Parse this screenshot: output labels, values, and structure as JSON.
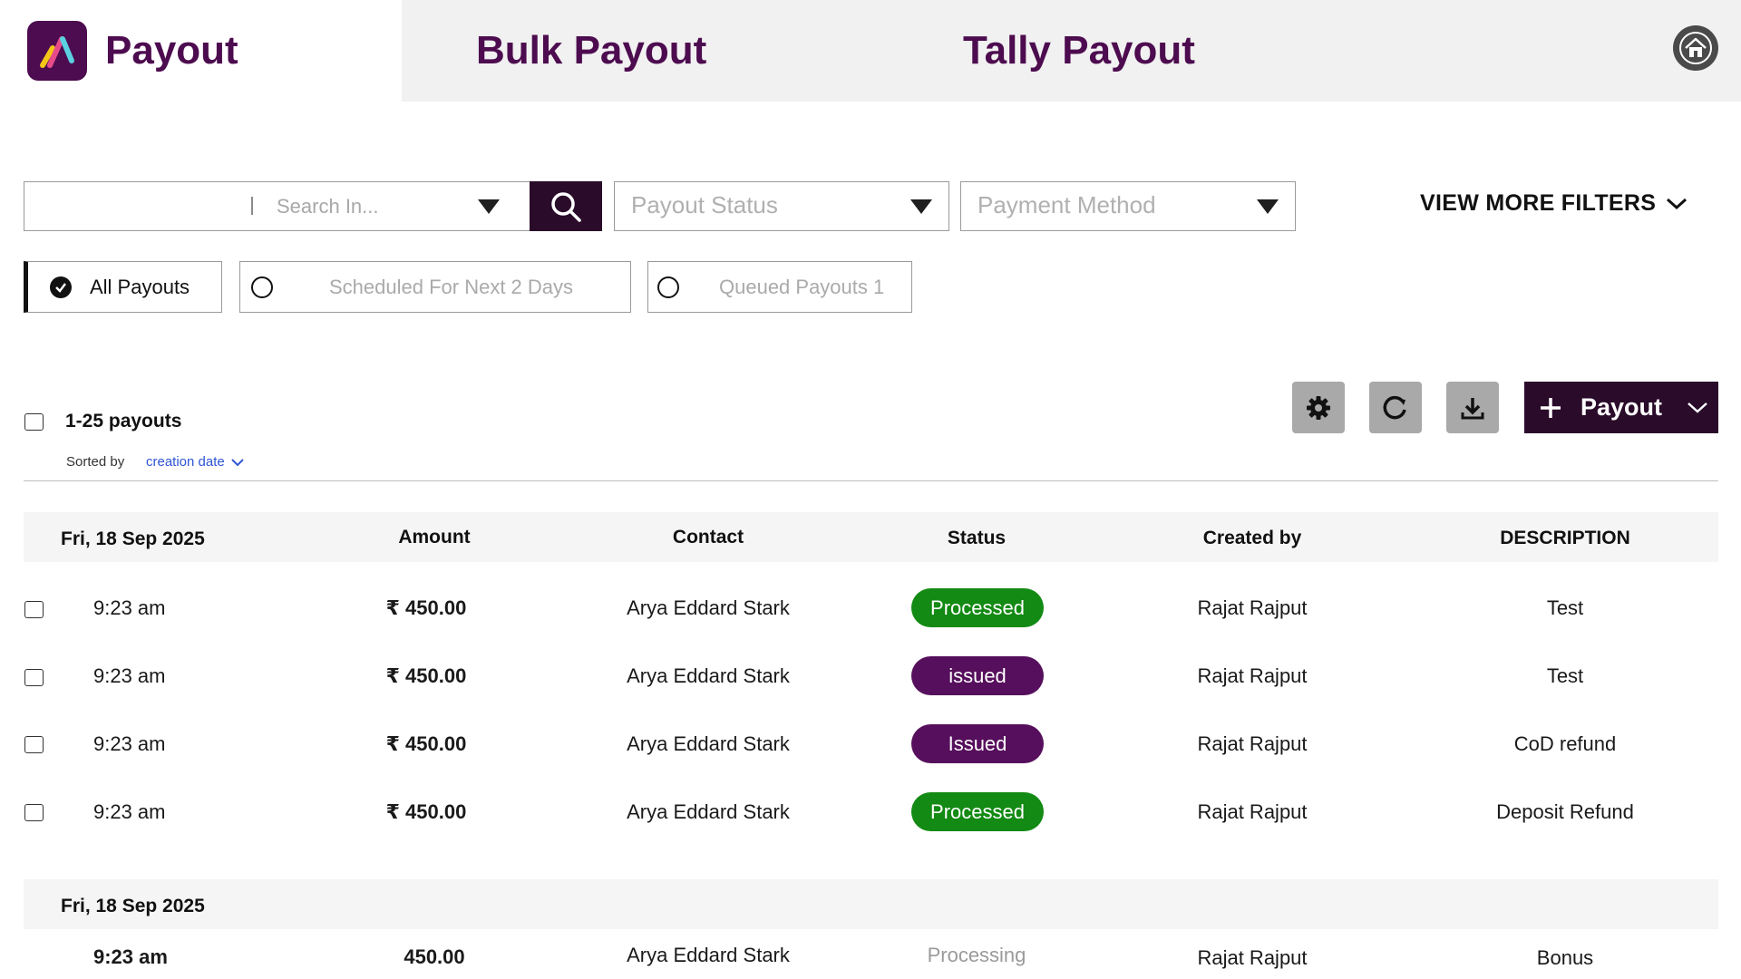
{
  "tabs": {
    "payout": "Payout",
    "bulk": "Bulk Payout",
    "tally": "Tally Payout"
  },
  "filters": {
    "search_in": "Search In...",
    "payout_status": "Payout Status",
    "payment_method": "Payment Method",
    "view_more": "VIEW MORE FILTERS"
  },
  "quick_filters": {
    "all": "All Payouts",
    "scheduled": "Scheduled For Next 2 Days",
    "queued": "Queued Payouts 1"
  },
  "list": {
    "count": "1-25 payouts",
    "sorted_by": "Sorted by",
    "sort_field": "creation date",
    "add_payout": "Payout"
  },
  "columns": {
    "date": "Fri, 18 Sep 2025",
    "amount": "Amount",
    "contact": "Contact",
    "status": "Status",
    "created_by": "Created by",
    "description": "DESCRIPTION"
  },
  "rows": [
    {
      "time": "9:23 am",
      "amount": "₹ 450.00",
      "contact": "Arya Eddard Stark",
      "status": "Processed",
      "created_by": "Rajat Rajput",
      "description": "Test"
    },
    {
      "time": "9:23 am",
      "amount": "₹ 450.00",
      "contact": "Arya Eddard Stark",
      "status": "issued",
      "created_by": "Rajat Rajput",
      "description": "Test"
    },
    {
      "time": "9:23 am",
      "amount": "₹ 450.00",
      "contact": "Arya Eddard Stark",
      "status": "Issued",
      "created_by": "Rajat Rajput",
      "description": "CoD refund"
    },
    {
      "time": "9:23 am",
      "amount": "₹ 450.00",
      "contact": "Arya Eddard Stark",
      "status": "Processed",
      "created_by": "Rajat Rajput",
      "description": "Deposit Refund"
    }
  ],
  "group2": {
    "date": "Fri, 18 Sep 2025",
    "row": {
      "time": "9:23 am",
      "amount": "450.00",
      "contact": "Arya Eddard Stark",
      "status": "Processing",
      "created_by": "Rajat Rajput",
      "description": "Bonus"
    }
  },
  "colors": {
    "brand": "#4d0c4f",
    "dark_button": "#2a0b2a",
    "processed": "#138a13",
    "issued": "#560f5c",
    "processing_text": "#9a9a9a",
    "link": "#2f55d4"
  }
}
